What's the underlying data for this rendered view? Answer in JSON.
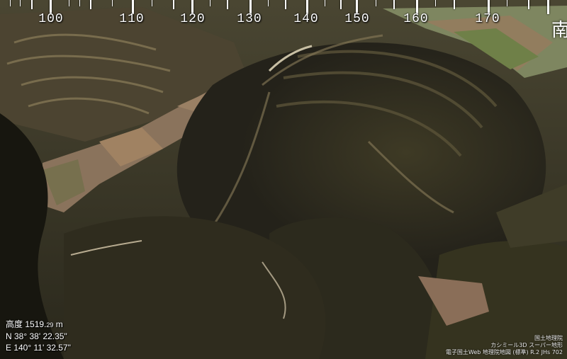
{
  "compass": {
    "ticks": [
      {
        "label": "100"
      },
      {
        "label": "110"
      },
      {
        "label": "120"
      },
      {
        "label": "130"
      },
      {
        "label": "140"
      },
      {
        "label": "150"
      },
      {
        "label": "160"
      },
      {
        "label": "170"
      }
    ],
    "direction_label": "南"
  },
  "readout": {
    "altitude_label": "高度",
    "altitude_int": "1519.",
    "altitude_frac": "29",
    "altitude_unit": "m",
    "latitude": "N  38° 38' 22.35\"",
    "longitude": "E 140° 11' 32.57\""
  },
  "attribution": {
    "line1": "国土地理院",
    "line2": "カシミール3D スーパー地形",
    "line3": "電子国土Web 地理院地図 (標準) R.2 JHs 702"
  },
  "colors": {
    "forest": "#3a3520",
    "ridge_light": "#8a7d5a",
    "shadow": "#14130d",
    "field": "#8e7a62",
    "field_green": "#7b8a5a"
  }
}
